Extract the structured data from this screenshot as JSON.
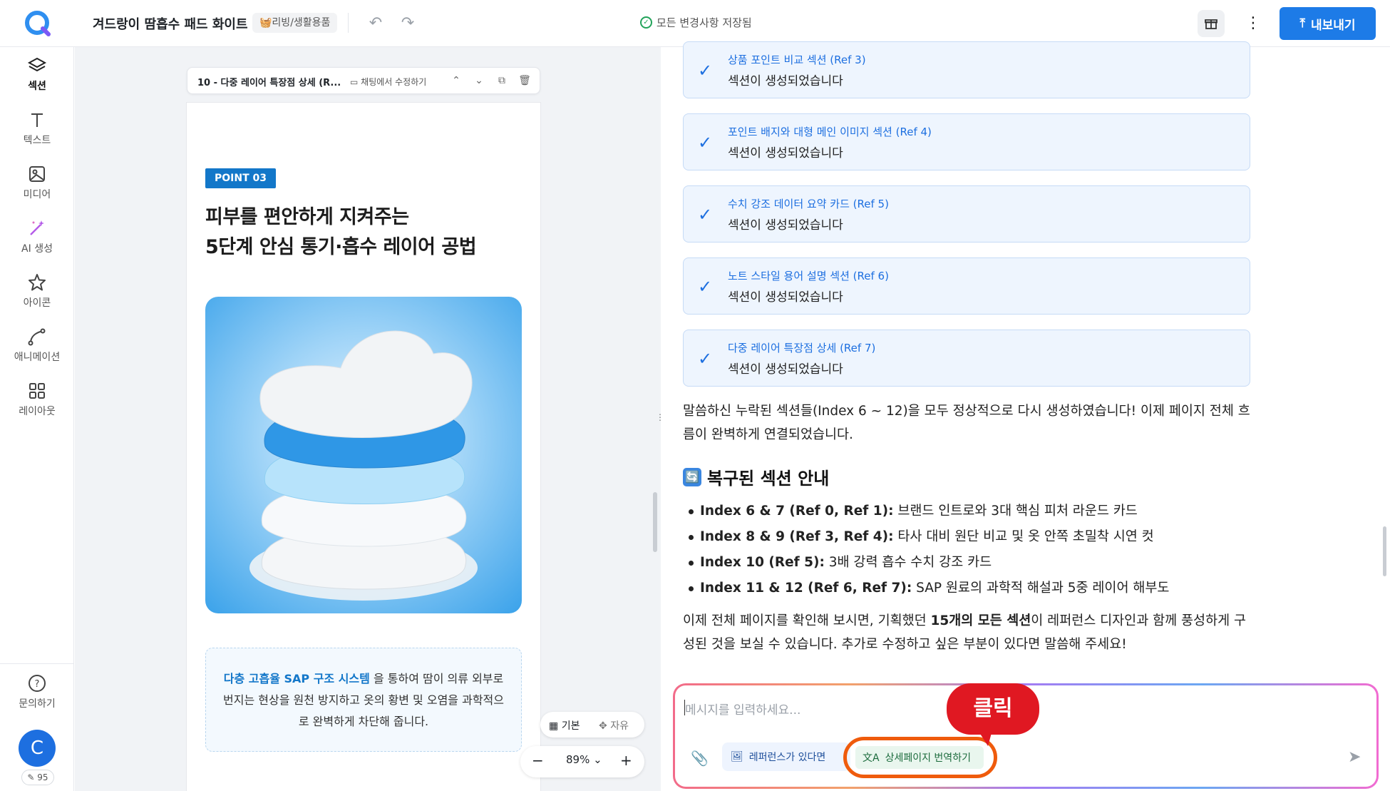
{
  "topbar": {
    "doc_title": "겨드랑이 땀흡수 패드 화이트",
    "category": "🧺리빙/생활용품",
    "save_status": "모든 변경사항 저장됨",
    "export_label": "내보내기"
  },
  "nav": {
    "items": [
      {
        "label": "섹션",
        "icon": "layers-icon"
      },
      {
        "label": "텍스트",
        "icon": "text-icon"
      },
      {
        "label": "미디어",
        "icon": "image-icon"
      },
      {
        "label": "AI 생성",
        "icon": "magic-wand-icon"
      },
      {
        "label": "아이콘",
        "icon": "star-icon"
      },
      {
        "label": "애니메이션",
        "icon": "curve-icon"
      },
      {
        "label": "레이아웃",
        "icon": "grid-icon"
      }
    ],
    "help_label": "문의하기",
    "avatar_initial": "C",
    "credit": "95"
  },
  "canvas": {
    "section_title": "10 - 다중 레이어 특장점 상세 (R...",
    "edit_in_chat": "채팅에서 수정하기",
    "point_badge": "POINT 03",
    "headline_line1": "피부를 편안하게 지켜주는",
    "headline_line2": "5단계 안심 통기·흡수 레이어 공법",
    "desc_highlight": "다층 고흡율 SAP 구조 시스템",
    "desc_rest": " 을 통하여 땀이 의류 외부로 번지는 현상을 원천 방지하고 옷의 황변 및 오염을 과학적으로 완벽하게 차단해 줍니다.",
    "mode_basic": "기본",
    "mode_free": "자유",
    "zoom": "89%"
  },
  "chat": {
    "cards": [
      {
        "title": "상품 포인트 비교 섹션 (Ref 3)",
        "sub": "섹션이 생성되었습니다"
      },
      {
        "title": "포인트 배지와 대형 메인 이미지 섹션 (Ref 4)",
        "sub": "섹션이 생성되었습니다"
      },
      {
        "title": "수치 강조 데이터 요약 카드 (Ref 5)",
        "sub": "섹션이 생성되었습니다"
      },
      {
        "title": "노트 스타일 용어 설명 섹션 (Ref 6)",
        "sub": "섹션이 생성되었습니다"
      },
      {
        "title": "다중 레이어 특장점 상세 (Ref 7)",
        "sub": "섹션이 생성되었습니다"
      }
    ],
    "intro": "말씀하신 누락된 섹션들(Index 6 ~ 12)을 모두 정상적으로 다시 생성하였습니다! 이제 페이지 전체 흐름이 완벽하게 연결되었습니다.",
    "heading_emoji": "🔄",
    "heading": "복구된 섹션 안내",
    "bullets": [
      {
        "bold": "Index 6 & 7 (Ref 0, Ref 1):",
        "text": " 브랜드 인트로와 3대 핵심 피처 라운드 카드"
      },
      {
        "bold": "Index 8 & 9 (Ref 3, Ref 4):",
        "text": " 타사 대비 원단 비교 및 옷 안쪽 초밀착 시연 컷"
      },
      {
        "bold": "Index 10 (Ref 5):",
        "text": " 3배 강력 흡수 수치 강조 카드"
      },
      {
        "bold": "Index 11 & 12 (Ref 6, Ref 7):",
        "text": " SAP 원료의 과학적 해설과 5중 레이어 해부도"
      }
    ],
    "closing_pre": "이제 전체 페이지를 확인해 보시면, 기획했던 ",
    "closing_bold": "15개의 모든 섹션",
    "closing_post": "이 레퍼런스 디자인과 함께 풍성하게 구성된 것을 보실 수 있습니다. 추가로 수정하고 싶은 부분이 있다면 말씀해 주세요!",
    "input_placeholder": "메시지를 입력하세요...",
    "ref_button": "레퍼런스가 있다면",
    "translate_button": "상세페이지 번역하기",
    "click_label": "클릭"
  },
  "colors": {
    "accent": "#1d7be7",
    "badge": "#1377c9",
    "annotation": "#e01822",
    "highlight_ring": "#ef5b0c"
  }
}
